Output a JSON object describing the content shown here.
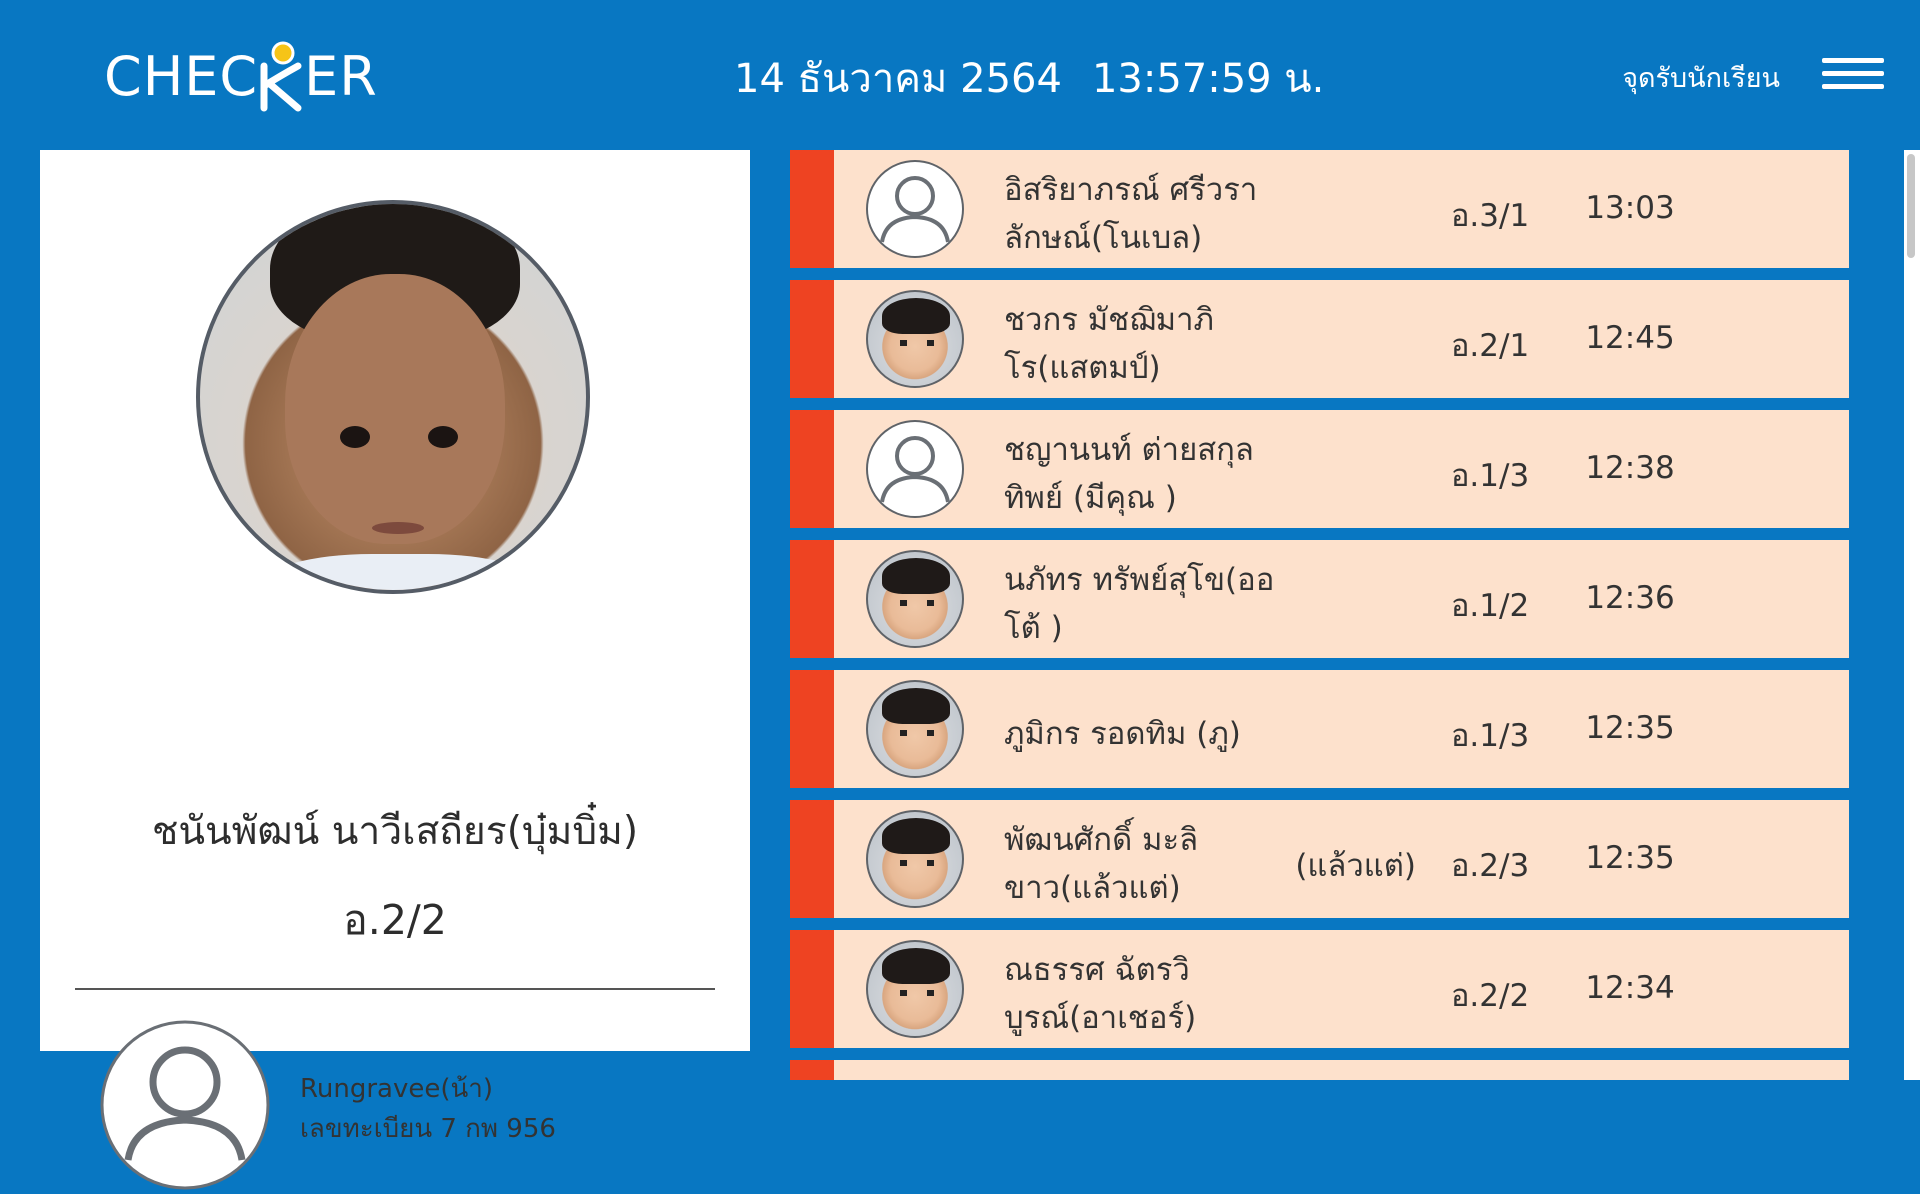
{
  "header": {
    "logo_text_left": "CHEC",
    "logo_text_right": "ER",
    "date": "14 ธันวาคม 2564",
    "time": "13:57:59 น.",
    "pickup_point_label": "จุดรับนักเรียน"
  },
  "selected_student": {
    "name": "ชนันพัฒน์ นาวีเสถียร(บุ๋มบิ๋ม)",
    "class": "อ.2/2",
    "guardian": {
      "name": "Rungravee(น้า)",
      "plate": "เลขทะเบียน 7 กพ 956"
    }
  },
  "pickup_list": [
    {
      "name_line1": "อิสริยาภรณ์ ศรีวรา",
      "name_line2": "ลักษณ์(โนเบล)",
      "nickname_tag": "",
      "class": "อ.3/1",
      "time": "13:03",
      "has_photo": false
    },
    {
      "name_line1": "ชวกร มัชฌิมาภิ",
      "name_line2": "โร(แสตมป์)",
      "nickname_tag": "",
      "class": "อ.2/1",
      "time": "12:45",
      "has_photo": true
    },
    {
      "name_line1": "ชญานนท์ ต่ายสกุล",
      "name_line2": "ทิพย์ (มีคุณ )",
      "nickname_tag": "",
      "class": "อ.1/3",
      "time": "12:38",
      "has_photo": false
    },
    {
      "name_line1": "นภัทร ทรัพย์สุโข(ออ",
      "name_line2": "โต้ )",
      "nickname_tag": "",
      "class": "อ.1/2",
      "time": "12:36",
      "has_photo": true
    },
    {
      "name_line1": "ภูมิกร รอดทิม (ภู)",
      "name_line2": "",
      "nickname_tag": "",
      "class": "อ.1/3",
      "time": "12:35",
      "has_photo": true
    },
    {
      "name_line1": "พัฒนศักดิ์ มะลิ",
      "name_line2": "ขาว(แล้วแต่)",
      "nickname_tag": "(แล้วแต่)",
      "class": "อ.2/3",
      "time": "12:35",
      "has_photo": true
    },
    {
      "name_line1": "ณธรรศ ฉัตรวิ",
      "name_line2": "บูรณ์(อาเชอร์)",
      "nickname_tag": "",
      "class": "อ.2/2",
      "time": "12:34",
      "has_photo": true
    }
  ],
  "colors": {
    "background_blue": "#0877c2",
    "row_background": "#fde1cc",
    "status_bar_red": "#ee4322",
    "logo_dot_yellow": "#f6c417"
  },
  "icons": {
    "menu": "hamburger-menu-icon",
    "default_avatar": "user-placeholder-icon"
  }
}
